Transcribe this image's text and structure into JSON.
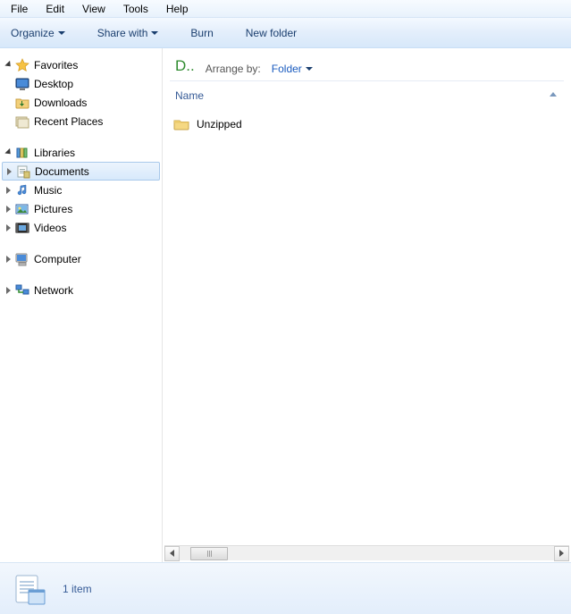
{
  "menu": {
    "items": [
      "File",
      "Edit",
      "View",
      "Tools",
      "Help"
    ]
  },
  "toolbar": {
    "organize": "Organize",
    "share": "Share with",
    "burn": "Burn",
    "newfolder": "New folder"
  },
  "nav": {
    "favorites": {
      "label": "Favorites",
      "items": [
        {
          "label": "Desktop",
          "icon": "desktop"
        },
        {
          "label": "Downloads",
          "icon": "folder-dl"
        },
        {
          "label": "Recent Places",
          "icon": "recent"
        }
      ]
    },
    "libraries": {
      "label": "Libraries",
      "items": [
        {
          "label": "Documents",
          "icon": "lib-doc",
          "selected": true
        },
        {
          "label": "Music",
          "icon": "lib-music"
        },
        {
          "label": "Pictures",
          "icon": "lib-pic"
        },
        {
          "label": "Videos",
          "icon": "lib-vid"
        }
      ]
    },
    "computer": {
      "label": "Computer"
    },
    "network": {
      "label": "Network"
    }
  },
  "content": {
    "path": "D..",
    "arrange_label": "Arrange by:",
    "arrange_value": "Folder",
    "columns": [
      "Name"
    ],
    "items": [
      {
        "name": "Unzipped",
        "type": "folder"
      }
    ]
  },
  "status": {
    "count": "1 item"
  }
}
